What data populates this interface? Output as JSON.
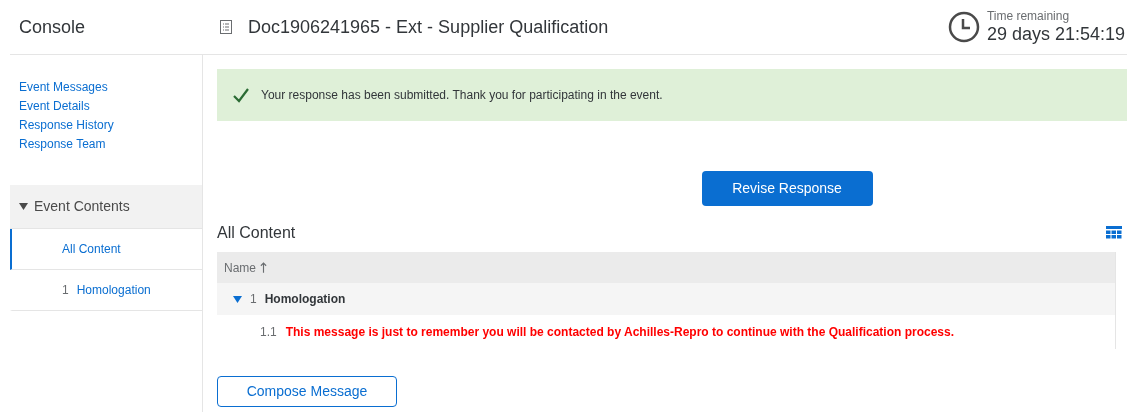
{
  "header": {
    "console": "Console",
    "document_title": "Doc1906241965 - Ext - Supplier Qualification",
    "timer_label": "Time remaining",
    "timer_value": "29 days 21:54:19"
  },
  "sidebar": {
    "links": [
      "Event Messages",
      "Event Details",
      "Response History",
      "Response Team"
    ],
    "section": {
      "label": "Event Contents",
      "expanded": true
    },
    "items": [
      {
        "label": "All Content",
        "selected": true
      },
      {
        "number": "1",
        "label": "Homologation",
        "selected": false
      }
    ]
  },
  "banner": {
    "message": "Your response has been submitted. Thank you for participating in the event."
  },
  "revise_button": "Revise Response",
  "content": {
    "title": "All Content",
    "table": {
      "columns": [
        "Name"
      ],
      "rows": [
        {
          "number": "1",
          "label": "Homologation",
          "expanded": true,
          "children": [
            {
              "number": "1.1",
              "label": "This message is just to remember you will be contacted by Achilles-Repro to continue with the Qualification process."
            }
          ]
        }
      ]
    }
  },
  "compose_button": "Compose Message"
}
